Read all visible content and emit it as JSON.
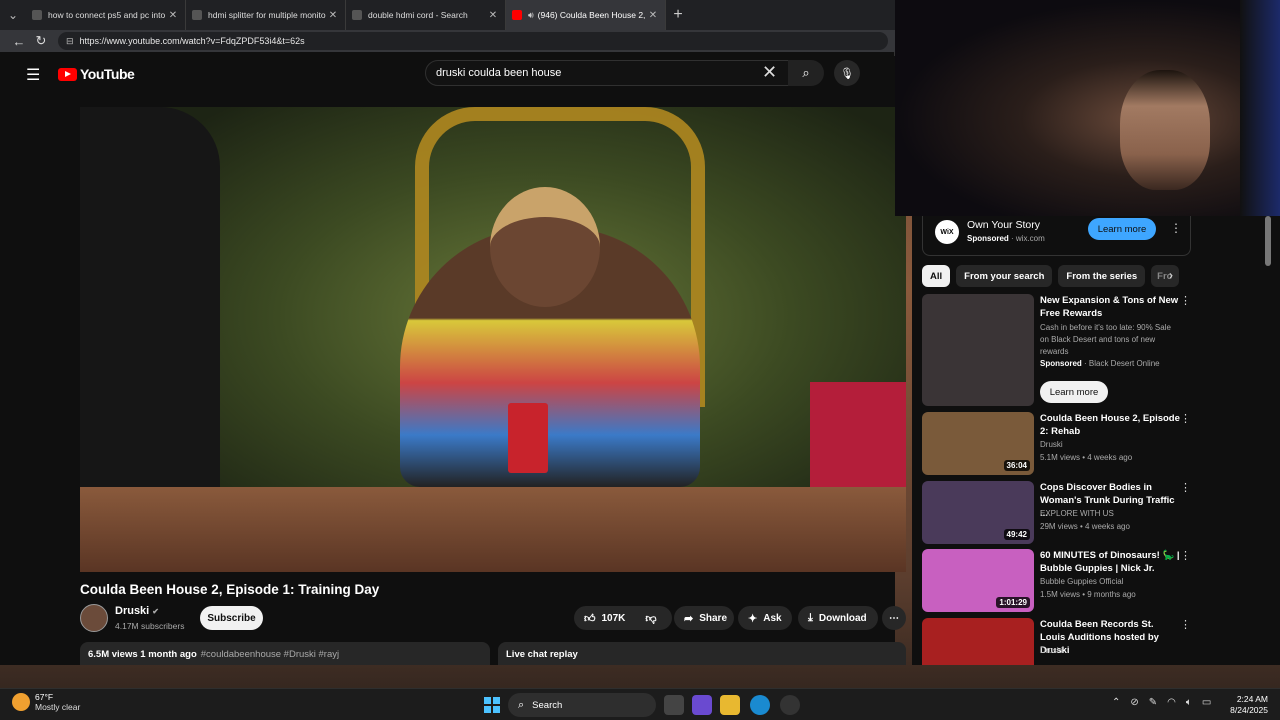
{
  "browser": {
    "tabs": [
      {
        "title": "how to connect ps5 and pc into a"
      },
      {
        "title": "hdmi splitter for multiple monito"
      },
      {
        "title": "double hdmi cord - Search"
      },
      {
        "title": "(946) Coulda Been House 2,"
      }
    ],
    "url": "https://www.youtube.com/watch?v=FdqZPDF53i4&t=62s"
  },
  "youtube": {
    "logo_text": "YouTube",
    "search_query": "druski coulda been house",
    "video": {
      "title": "Coulda Been House 2, Episode 1: Training Day",
      "channel": "Druski",
      "subscribers": "4.17M subscribers",
      "subscribe_label": "Subscribe",
      "likes": "107K",
      "share_label": "Share",
      "ask_label": "Ask",
      "download_label": "Download",
      "views_age": "6.5M views  1 month ago",
      "tags": "#couldabeenhouse #Druski #rayj",
      "live_chat": "Live chat replay"
    },
    "ad": {
      "logo": "WiX",
      "title": "Own Your Story",
      "sponsored": "Sponsored",
      "domain": "wix.com",
      "cta": "Learn more"
    },
    "chips": [
      "All",
      "From your search",
      "From the series",
      "Fro"
    ],
    "recommendations": [
      {
        "title": "New Expansion & Tons of New Free Rewards",
        "desc": "Cash in before it's too late: 90% Sale on Black Desert and tons of new rewards",
        "sponsored": "Sponsored",
        "advertiser": "Black Desert Online",
        "cta": "Learn more",
        "thumb_color": "#3a3436"
      },
      {
        "title": "Coulda Been House 2, Episode 2: Rehab",
        "channel": "Druski",
        "meta": "5.1M views • 4 weeks ago",
        "duration": "36:04",
        "thumb_color": "#7a5a3a"
      },
      {
        "title": "Cops Discover Bodies in Woman's Trunk During Traffic ...",
        "channel": "EXPLORE WITH US",
        "meta": "29M views • 4 weeks ago",
        "duration": "49:42",
        "thumb_color": "#4a3a5a"
      },
      {
        "title": "60 MINUTES of Dinosaurs! 🦕 | Bubble Guppies | Nick Jr.",
        "channel": "Bubble Guppies Official",
        "meta": "1.5M views • 9 months ago",
        "duration": "1:01:29",
        "thumb_color": "#c860c0"
      },
      {
        "title": "Coulda Been Records St. Louis Auditions hosted by Druski",
        "channel": "Druski",
        "meta": "",
        "duration": "",
        "thumb_color": "#a82020"
      }
    ]
  },
  "taskbar": {
    "weather_temp": "67°F",
    "weather_desc": "Mostly clear",
    "search_label": "Search",
    "time": "2:24 AM",
    "date": "8/24/2025"
  },
  "colors": {
    "youtube_red": "#ff0000",
    "accent_blue": "#3ea6ff"
  }
}
